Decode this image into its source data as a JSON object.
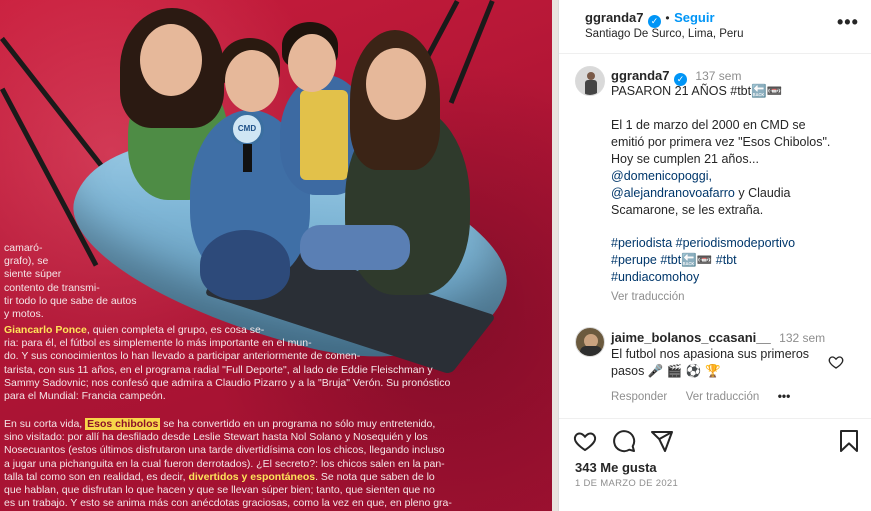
{
  "header": {
    "username": "ggranda7",
    "follow_label": "Seguir",
    "location": "Santiago De Surco, Lima, Peru",
    "more_label": "•••"
  },
  "caption": {
    "username": "ggranda7",
    "time": "137 sem",
    "line1": "PASARON 21 AÑOS #tbt🔙📼",
    "body": [
      "El 1 de marzo del 2000 en CMD se",
      "emitió por primera vez \"Esos Chibolos\".",
      "Hoy se cumplen 21 años...",
      "@domenicopoggi,",
      "@alejandranovoafarro y Claudia",
      "Scamarone, se les extraña."
    ],
    "hashtags": [
      "#periodista #periodismodeportivo",
      "#perupe #tbt🔙📼 #tbt",
      "#undiacomohoy"
    ],
    "translate_label": "Ver traducción"
  },
  "comment": {
    "username": "jaime_bolanos_ccasani__",
    "time": "132 sem",
    "line1": "El futbol nos apasiona sus primeros",
    "line2": "pasos 🎤 🎬 ⚽ 🏆",
    "reply_label": "Responder",
    "translate_label": "Ver traducción",
    "more_label": "•••"
  },
  "footer": {
    "likes": "343 Me gusta",
    "date": "1 DE MARZO DE 2021"
  },
  "article": {
    "intro": [
      "camaró-",
      "grafo), se",
      "siente súper",
      "contento de transmi-",
      "tir todo lo que sabe de autos",
      "y motos."
    ],
    "p1_name": "Giancarlo Ponce",
    "p1_rest": ", quien completa el grupo, es cosa se-",
    "p1_lines": [
      "ria: para él, el fútbol es simplemente lo más importante en el mun-",
      "do. Y sus conocimientos lo han llevado a participar anteriormente de comen-",
      "tarista, con sus 11 años, en el programa radial \"Full Deporte\", al lado de Eddie Fleischman y",
      "Sammy Sadovnic; nos confesó que admira a Claudio Pizarro y a la \"Bruja\" Verón. Su pronóstico",
      "para el Mundial: Francia campeón."
    ],
    "p2_start": "En su corta vida,",
    "p2_show": "Esos chibolos",
    "p2_rest": "se ha convertido en un programa no sólo muy entretenido,",
    "p2_lines": [
      "sino visitado: por allí ha desfilado desde Leslie Stewart hasta Nol Solano y Nosequién y los",
      "Nosecuantos (estos últimos disfrutaron una tarde divertidísima con los chicos, llegando incluso",
      "a jugar una pichanguita en la cual fueron derrotados). ¿El secreto?: los chicos salen en la pan-",
      "talla tal como son en realidad, es decir,",
      "que hablan, que disfrutan lo que hacen y que se llevan súper bien; tanto, que sienten que no",
      "es un trabajo. Y esto se anima más con anécdotas graciosas, como la vez en que, en pleno gra-"
    ],
    "p2_emph": "divertidos y espontáneos",
    "p2_after": ". Se nota que saben de lo",
    "mic_label": "CMD"
  },
  "colors": {
    "accent": "#0095f6",
    "link": "#00376b",
    "muted": "#8e8e8e",
    "photo_bg": "#b01535"
  },
  "icons": {
    "heart": "heart-icon",
    "comment": "comment-icon",
    "share": "share-icon",
    "bookmark": "bookmark-icon"
  }
}
